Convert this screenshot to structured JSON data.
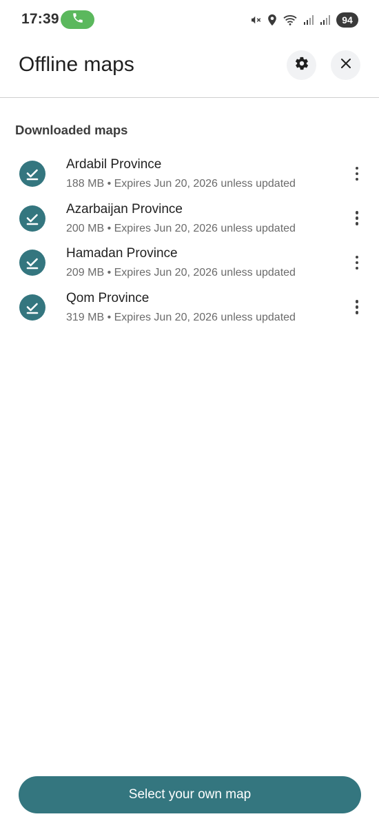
{
  "status_bar": {
    "time": "17:39",
    "battery": "94",
    "icons": [
      "phone-call-icon",
      "mute-vibrate-icon",
      "location-icon",
      "wifi-icon",
      "signal-icon",
      "signal-icon",
      "battery-icon"
    ]
  },
  "header": {
    "title": "Offline maps",
    "settings_icon": "gear-icon",
    "close_icon": "close-icon"
  },
  "section": {
    "heading": "Downloaded maps"
  },
  "maps": [
    {
      "name": "Ardabil Province",
      "meta": "188 MB • Expires Jun 20, 2026 unless updated",
      "icon": "download-done-icon"
    },
    {
      "name": "Azarbaijan Province",
      "meta": "200 MB • Expires Jun 20, 2026 unless updated",
      "icon": "download-done-icon"
    },
    {
      "name": "Hamadan Province",
      "meta": "209 MB • Expires Jun 20, 2026 unless updated",
      "icon": "download-done-icon"
    },
    {
      "name": "Qom Province",
      "meta": "319 MB • Expires Jun 20, 2026 unless updated",
      "icon": "download-done-icon"
    }
  ],
  "footer": {
    "select_button": "Select your own map"
  },
  "colors": {
    "accent": "#34767f",
    "call_green": "#5bb85d"
  }
}
